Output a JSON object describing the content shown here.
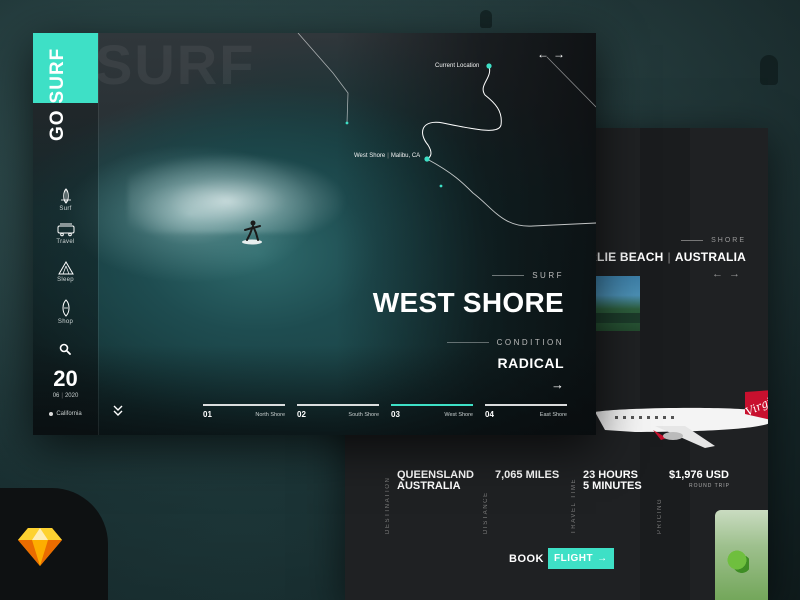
{
  "brand": {
    "go": "GO",
    "surf": "SURF",
    "ghost": "SURF"
  },
  "sidebar": {
    "items": [
      {
        "label": "Surf",
        "icon": "surfboard-icon"
      },
      {
        "label": "Travel",
        "icon": "van-icon"
      },
      {
        "label": "Sleep",
        "icon": "tent-icon"
      },
      {
        "label": "Shop",
        "icon": "board-shop-icon"
      }
    ],
    "date": {
      "day": "20",
      "month": "06",
      "year": "2020"
    },
    "location": "California"
  },
  "map": {
    "current_location": "Current Location",
    "west_shore_pin": "West Shore",
    "west_shore_city": "Malibu, CA"
  },
  "hero": {
    "category_label": "SURF",
    "title": "WEST SHORE",
    "condition_label": "CONDITION",
    "condition_value": "RADICAL",
    "arrow": "→"
  },
  "nav_arrows": "←→",
  "tabs": [
    {
      "num": "01",
      "name": "North Shore",
      "active": false
    },
    {
      "num": "02",
      "name": "South Shore",
      "active": false
    },
    {
      "num": "03",
      "name": "West Shore",
      "active": true
    },
    {
      "num": "04",
      "name": "East Shore",
      "active": false
    }
  ],
  "back_card": {
    "shore_label": "SHORE",
    "shore_name_a": "AIRLIE BEACH",
    "shore_name_b": "AUSTRALIA",
    "shore_arrows": "←→",
    "stats": {
      "destination": {
        "label": "DESTINATION",
        "line1": "QUEENSLAND",
        "line2": "AUSTRALIA"
      },
      "distance": {
        "label": "DISTANCE",
        "value": "7,065 MILES"
      },
      "travel_time": {
        "label": "TRAVEL TIME",
        "line1": "23 HOURS",
        "line2": "5 MINUTES"
      },
      "pricing": {
        "label": "PRICING",
        "value": "$1,976 USD",
        "sub": "ROUND TRIP"
      }
    },
    "book": "BOOK",
    "flight": "FLIGHT",
    "flight_arrow": "→"
  },
  "colors": {
    "accent": "#3ee0c6",
    "card_back": "#1f2123",
    "plane_red": "#c8102e"
  }
}
